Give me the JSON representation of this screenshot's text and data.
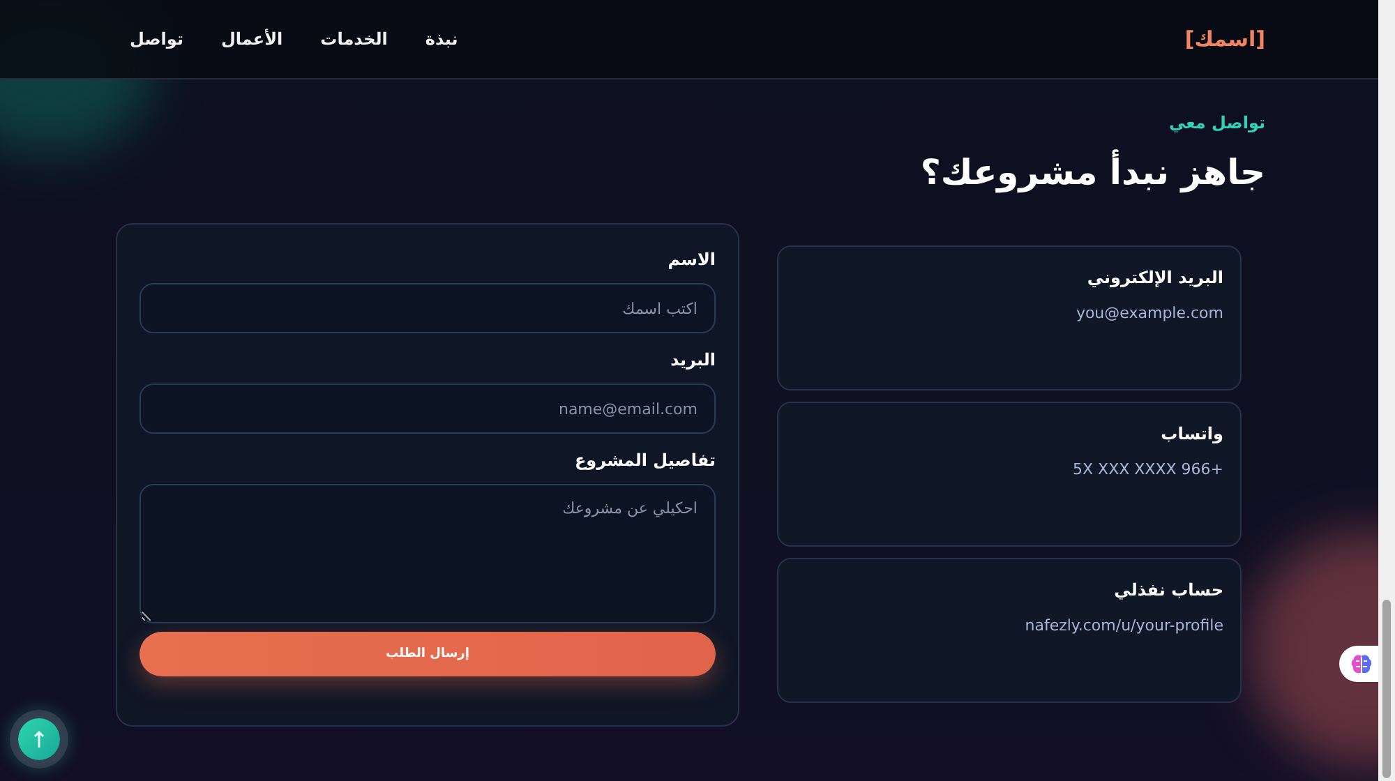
{
  "header": {
    "logo": "[اسمك]",
    "nav": [
      "نبذة",
      "الخدمات",
      "الأعمال",
      "تواصل"
    ]
  },
  "section": {
    "kicker": "تواصل معي",
    "heading": "جاهز نبدأ مشروعك؟"
  },
  "contact_cards": [
    {
      "title": "البريد الإلكتروني",
      "value": "you@example.com"
    },
    {
      "title": "واتساب",
      "value": "5X XXX XXXX 966+"
    },
    {
      "title": "حساب نفذلي",
      "value": "nafezly.com/u/your-profile"
    }
  ],
  "form": {
    "fields": [
      {
        "kind": "input",
        "label": "الاسم",
        "placeholder": "اكتب اسمك"
      },
      {
        "kind": "input",
        "label": "البريد",
        "placeholder": "name@email.com"
      },
      {
        "kind": "textarea",
        "label": "تفاصيل المشروع",
        "placeholder": "احكيلي عن مشروعك"
      }
    ],
    "submit": "إرسال الطلب"
  }
}
